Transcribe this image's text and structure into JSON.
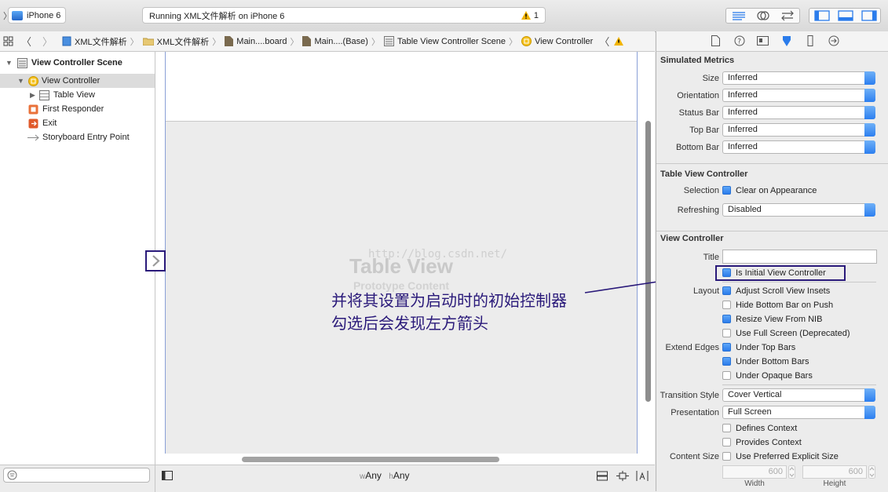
{
  "toolbar": {
    "scheme_device": "iPhone 6",
    "activity_text": "Running XML文件解析 on iPhone 6",
    "warning_count": "1"
  },
  "jumpbar": {
    "items": [
      "XML文件解析",
      "XML文件解析",
      "Main....board",
      "Main....(Base)",
      "Table View Controller Scene",
      "View Controller"
    ]
  },
  "outline": {
    "scene": "View Controller Scene",
    "items": [
      "View Controller",
      "Table View",
      "First Responder",
      "Exit",
      "Storyboard Entry Point"
    ]
  },
  "canvas": {
    "placeholder_title": "Table View",
    "placeholder_subtitle": "Prototype Content",
    "watermark": "http://blog.csdn.net/",
    "annotation_line1": "并将其设置为启动时的初始控制器",
    "annotation_line2": "勾选后会发现左方箭头",
    "size_class_w_prefix": "w",
    "size_class_w": "Any",
    "size_class_h_prefix": "h",
    "size_class_h": "Any"
  },
  "colors": {
    "annotation": "#2a1a7a",
    "accent": "#2b7ceb",
    "canvas_bg": "#ececec"
  },
  "inspector": {
    "simulated_metrics": {
      "title": "Simulated Metrics",
      "rows": [
        {
          "label": "Size",
          "value": "Inferred"
        },
        {
          "label": "Orientation",
          "value": "Inferred"
        },
        {
          "label": "Status Bar",
          "value": "Inferred"
        },
        {
          "label": "Top Bar",
          "value": "Inferred"
        },
        {
          "label": "Bottom Bar",
          "value": "Inferred"
        }
      ]
    },
    "table_view_controller": {
      "title": "Table View Controller",
      "selection_label": "Selection",
      "selection_value": "Clear on Appearance",
      "refreshing_label": "Refreshing",
      "refreshing_value": "Disabled"
    },
    "view_controller": {
      "title": "View Controller",
      "title_label": "Title",
      "title_value": "",
      "initial_vc": "Is Initial View Controller",
      "layout_label": "Layout",
      "layout_options": [
        {
          "label": "Adjust Scroll View Insets",
          "checked": true
        },
        {
          "label": "Hide Bottom Bar on Push",
          "checked": false
        },
        {
          "label": "Resize View From NIB",
          "checked": true
        },
        {
          "label": "Use Full Screen (Deprecated)",
          "checked": false
        }
      ],
      "extend_edges_label": "Extend Edges",
      "extend_options": [
        {
          "label": "Under Top Bars",
          "checked": true
        },
        {
          "label": "Under Bottom Bars",
          "checked": true
        },
        {
          "label": "Under Opaque Bars",
          "checked": false
        }
      ],
      "transition_label": "Transition Style",
      "transition_value": "Cover Vertical",
      "presentation_label": "Presentation",
      "presentation_value": "Full Screen",
      "context_options": [
        {
          "label": "Defines Context",
          "checked": false
        },
        {
          "label": "Provides Context",
          "checked": false
        }
      ],
      "content_size_label": "Content Size",
      "content_size_option": "Use Preferred Explicit Size",
      "width_value": "600",
      "height_value": "600",
      "width_label": "Width",
      "height_label": "Height"
    }
  }
}
